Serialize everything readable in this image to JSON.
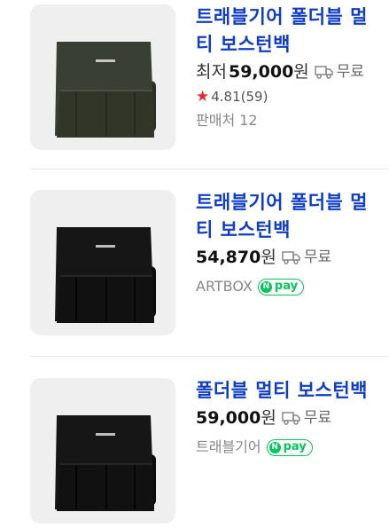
{
  "products": [
    {
      "title_line1": "트래블기어 폴더블 멀",
      "title_line2": "티 보스턴백",
      "price_prefix": "최저",
      "price": "59,000",
      "currency": "원",
      "shipping": "무료",
      "rating_icon": "star-icon",
      "rating": "4.81",
      "review_count": "(59)",
      "seller": "판매처 12",
      "bag_color": "#3a3f33"
    },
    {
      "title_line1": "트래블기어 폴더블 멀",
      "title_line2": "티 보스턴백",
      "price": "54,870",
      "currency": "원",
      "shipping": "무료",
      "seller": "ARTBOX",
      "npay_label": "pay",
      "npay_n": "N",
      "bag_color": "#161616"
    },
    {
      "title_line1": "폴더블 멀티 보스턴백",
      "price": "59,000",
      "currency": "원",
      "shipping": "무료",
      "seller": "트래블기어",
      "npay_label": "pay",
      "npay_n": "N",
      "bag_color": "#161616"
    }
  ]
}
